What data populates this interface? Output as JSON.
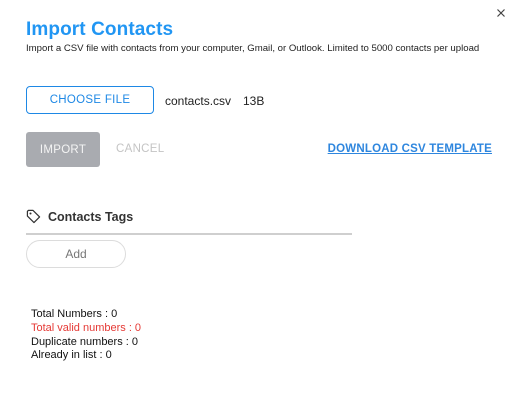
{
  "dialog": {
    "title": "Import Contacts",
    "subtitle": "Import a CSV file with contacts from your computer, Gmail, or Outlook. Limited to 5000 contacts per upload",
    "close_icon": "close-icon"
  },
  "file": {
    "choose_label": "CHOOSE FILE",
    "name": "contacts.csv",
    "size": "13B"
  },
  "actions": {
    "import_label": "IMPORT",
    "cancel_label": "CANCEL",
    "download_label": "DOWNLOAD CSV TEMPLATE"
  },
  "tags": {
    "icon": "tag-icon",
    "label": "Contacts Tags",
    "add_label": "Add"
  },
  "stats": {
    "total": "Total Numbers : 0",
    "valid": "Total valid numbers : 0",
    "duplicate": "Duplicate numbers : 0",
    "already": "Already in list : 0"
  },
  "colors": {
    "accent": "#2196f3",
    "button_outline": "#1e88e5",
    "disabled": "#a9abb0",
    "error": "#e53935"
  }
}
